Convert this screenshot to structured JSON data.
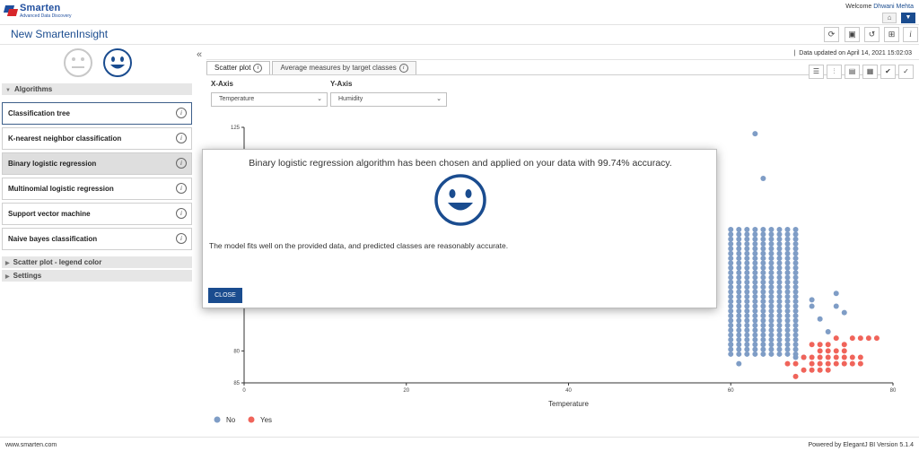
{
  "header": {
    "logo_brand": "Smarten",
    "logo_subtitle": "Advanced Data Discovery",
    "welcome_label": "Welcome",
    "user_name": "Dhwani Mehta"
  },
  "title_bar": {
    "title": "New SmartenInsight"
  },
  "sidebar": {
    "algorithms_header": "Algorithms",
    "algorithms": [
      {
        "label": "Classification tree"
      },
      {
        "label": "K-nearest neighbor classification"
      },
      {
        "label": "Binary logistic regression"
      },
      {
        "label": "Multinomial logistic regression"
      },
      {
        "label": "Support vector machine"
      },
      {
        "label": "Naive bayes classification"
      }
    ],
    "scatter_legend_header": "Scatter plot - legend color",
    "settings_header": "Settings"
  },
  "main": {
    "data_updated": "Data updated on April 14, 2021 15:02:03",
    "tabs": [
      {
        "label": "Scatter plot"
      },
      {
        "label": "Average measures by target classes"
      }
    ],
    "x_axis_label": "X-Axis",
    "y_axis_label": "Y-Axis",
    "x_axis_value": "Temperature",
    "y_axis_value": "Humidity"
  },
  "chart_data": {
    "type": "scatter",
    "xlabel": "Temperature",
    "ylabel": "",
    "xlim": [
      0,
      80
    ],
    "ylim": [
      85,
      125
    ],
    "x_ticks": [
      "0",
      "20",
      "40",
      "60",
      "80"
    ],
    "y_ticks": [
      {
        "value": 125,
        "label": "125"
      },
      {
        "value": 90,
        "label": "80"
      },
      {
        "value": 85,
        "label": "85"
      }
    ],
    "series": [
      {
        "name": "No",
        "color": "#7f9dc6",
        "points": [
          [
            28,
            101
          ],
          [
            63,
            124
          ],
          [
            64,
            117
          ],
          [
            60,
            91
          ],
          [
            61,
            88
          ],
          [
            68,
            89
          ],
          [
            69,
            89
          ],
          [
            70,
            97
          ],
          [
            71,
            95
          ],
          [
            72,
            93
          ],
          [
            73,
            97
          ],
          [
            73,
            99
          ],
          [
            74,
            96
          ],
          [
            70,
            98
          ]
        ],
        "grid": {
          "x_start": 60,
          "x_end": 68,
          "x_step": 1,
          "y_start": 89.5,
          "y_end": 109,
          "y_step": 0.75
        }
      },
      {
        "name": "Yes",
        "color": "#f0645a",
        "points": [
          [
            67,
            88
          ],
          [
            68,
            88
          ],
          [
            69,
            89
          ],
          [
            70,
            88
          ],
          [
            71,
            87
          ],
          [
            72,
            88
          ],
          [
            73,
            88
          ],
          [
            74,
            88
          ],
          [
            76,
            88
          ],
          [
            68,
            86
          ],
          [
            70,
            87
          ],
          [
            71,
            89
          ],
          [
            72,
            90
          ],
          [
            73,
            89
          ],
          [
            74,
            91
          ],
          [
            75,
            89
          ],
          [
            76,
            89
          ],
          [
            77,
            92
          ],
          [
            70,
            91
          ],
          [
            71,
            90
          ],
          [
            72,
            91
          ],
          [
            73,
            92
          ],
          [
            74,
            90
          ],
          [
            75,
            92
          ],
          [
            76,
            92
          ],
          [
            78,
            92
          ],
          [
            71,
            88
          ],
          [
            72,
            89
          ],
          [
            73,
            90
          ],
          [
            74,
            89
          ],
          [
            69,
            87
          ],
          [
            70,
            89
          ],
          [
            72,
            87
          ],
          [
            75,
            88
          ],
          [
            71,
            91
          ]
        ]
      }
    ],
    "legend": [
      "No",
      "Yes"
    ],
    "legend_position": "bottom-left"
  },
  "modal": {
    "message": "Binary logistic regression algorithm has been chosen and applied on your data with 99.74% accuracy.",
    "description": "The model fits well on the provided data, and predicted classes are reasonably accurate.",
    "close_label": "CLOSE"
  },
  "footer": {
    "left": "www.smarten.com",
    "right": "Powered by ElegantJ BI Version 5.1.4"
  },
  "colors": {
    "accent": "#1a4c8f",
    "no_series": "#7f9dc6",
    "yes_series": "#f0645a"
  }
}
